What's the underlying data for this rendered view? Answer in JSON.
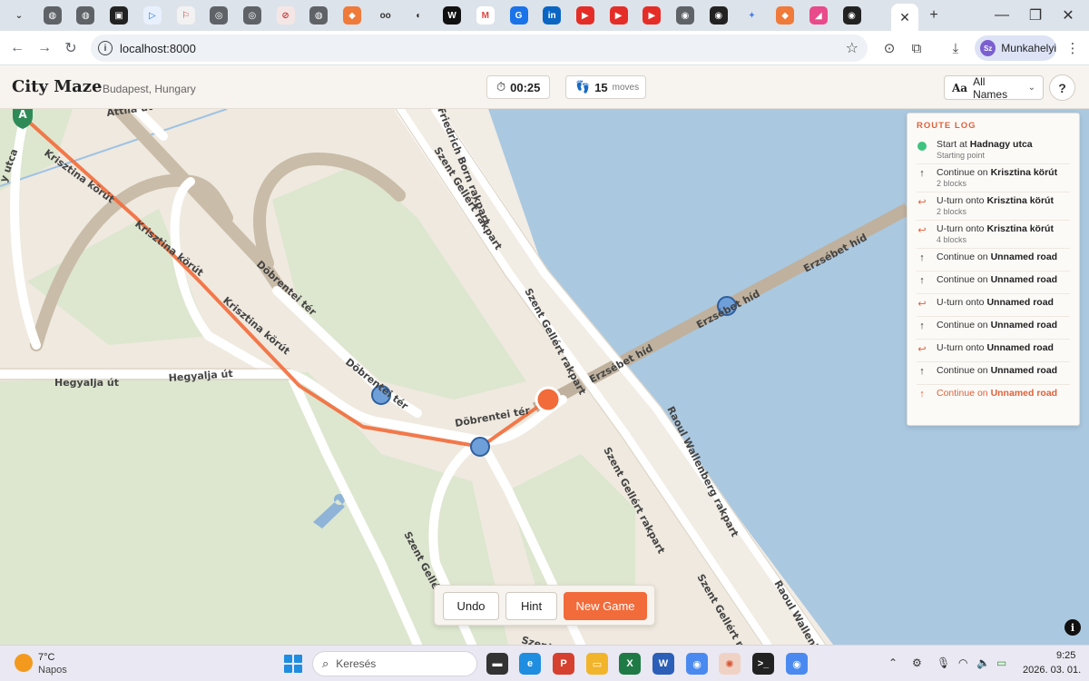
{
  "browser": {
    "favicons": [
      {
        "name": "menu-dropdown-icon",
        "glyph": "⌄",
        "bg": "#dde3ea",
        "fg": "#333"
      },
      {
        "name": "globe-icon",
        "glyph": "◍",
        "bg": "#5f6368",
        "fg": "#fff"
      },
      {
        "name": "globe-icon",
        "glyph": "◍",
        "bg": "#5f6368",
        "fg": "#fff"
      },
      {
        "name": "site-icon",
        "glyph": "▣",
        "bg": "#222",
        "fg": "#fff"
      },
      {
        "name": "play-icon",
        "glyph": "▷",
        "bg": "#e8f0fe",
        "fg": "#1a73e8"
      },
      {
        "name": "site-icon",
        "glyph": "⚐",
        "bg": "#f2f2f2",
        "fg": "#c33"
      },
      {
        "name": "globe-icon",
        "glyph": "◎",
        "bg": "#5f6368",
        "fg": "#fff"
      },
      {
        "name": "globe-icon",
        "glyph": "◎",
        "bg": "#5f6368",
        "fg": "#fff"
      },
      {
        "name": "site-icon",
        "glyph": "⊘",
        "bg": "#f5e6e6",
        "fg": "#c33"
      },
      {
        "name": "globe-icon",
        "glyph": "◍",
        "bg": "#5f6368",
        "fg": "#fff"
      },
      {
        "name": "site-icon",
        "glyph": "◆",
        "bg": "#f07a3a",
        "fg": "#fff"
      },
      {
        "name": "glasses-icon",
        "glyph": "oo",
        "bg": "#dde3ea",
        "fg": "#333"
      },
      {
        "name": "moon-icon",
        "glyph": "◐",
        "bg": "#dde3ea",
        "fg": "#222"
      },
      {
        "name": "site-icon",
        "glyph": "W",
        "bg": "#111",
        "fg": "#fff"
      },
      {
        "name": "gmail-icon",
        "glyph": "M",
        "bg": "#fff",
        "fg": "#d44"
      },
      {
        "name": "site-icon",
        "glyph": "G",
        "bg": "#1a73e8",
        "fg": "#fff"
      },
      {
        "name": "linkedin-icon",
        "glyph": "in",
        "bg": "#0a66c2",
        "fg": "#fff"
      },
      {
        "name": "youtube-icon",
        "glyph": "▶",
        "bg": "#e52d27",
        "fg": "#fff"
      },
      {
        "name": "youtube-icon",
        "glyph": "▶",
        "bg": "#e52d27",
        "fg": "#fff"
      },
      {
        "name": "youtube-icon",
        "glyph": "▶",
        "bg": "#e52d27",
        "fg": "#fff"
      },
      {
        "name": "site-icon",
        "glyph": "◉",
        "bg": "#5f6368",
        "fg": "#fff"
      },
      {
        "name": "github-icon",
        "glyph": "◉",
        "bg": "#222",
        "fg": "#fff"
      },
      {
        "name": "gemini-icon",
        "glyph": "✦",
        "bg": "#dde3ea",
        "fg": "#4a7de8"
      },
      {
        "name": "site-icon",
        "glyph": "◆",
        "bg": "#f07a3a",
        "fg": "#fff"
      },
      {
        "name": "site-icon",
        "glyph": "◢",
        "bg": "#e84a8a",
        "fg": "#fff"
      },
      {
        "name": "github-icon",
        "glyph": "◉",
        "bg": "#222",
        "fg": "#fff"
      }
    ],
    "url": "localhost:8000",
    "profile_initials": "Sz",
    "profile_name": "Munkahelyi"
  },
  "header": {
    "title": "City Maze",
    "subtitle": "Budapest, Hungary",
    "timer": "00:25",
    "moves_count": "15",
    "moves_label": "moves",
    "names_aa": "Aa",
    "names_selected": "All Names",
    "help": "?"
  },
  "map": {
    "labels": {
      "attila": "Attila út",
      "hegyalja1": "Hegyalja út",
      "hegyalja2": "Hegyalja út",
      "dobrentei1": "Döbrentei tér",
      "dobrentei2": "Döbrentei tér",
      "dobrentei3": "Döbrentei tér",
      "born": "Friedrich Born rakpart",
      "gellert1": "Szent Gellért rakpart",
      "gellert2": "Szent Gellért rakpart",
      "gellert3": "Szent Gellért rakpart",
      "gellert4": "Szent Gellért rakpart",
      "gellert5": "Szent Gellért r",
      "wallenberg1": "Raoul Wallenberg rakpart",
      "wallenberg2": "Raoul Wallenbe",
      "erzsebet1": "Erzsébet híd",
      "erzsebet2": "Erzsébet híd",
      "erzsebet3": "Erzsébet híd",
      "krisztina1": "Krisztina körút",
      "krisztina2": "Krisztina körút",
      "krisztina3": "Krisztina körút",
      "utca": "y utca",
      "szent_bottom": "Szent",
      "start_marker": "A"
    },
    "colors": {
      "water": "#aac8e0",
      "route": "#f26b3a",
      "park": "#dde6cf",
      "land": "#efe9df"
    }
  },
  "route_log": {
    "title": "ROUTE LOG",
    "items": [
      {
        "kind": "start",
        "action": "Start at",
        "street": "Hadnagy utca",
        "sub": "Starting point"
      },
      {
        "kind": "straight",
        "action": "Continue on",
        "street": "Krisztina körút",
        "sub": "2 blocks"
      },
      {
        "kind": "uturn",
        "action": "U-turn onto",
        "street": "Krisztina körút",
        "sub": "2 blocks"
      },
      {
        "kind": "uturn",
        "action": "U-turn onto",
        "street": "Krisztina körút",
        "sub": "4 blocks"
      },
      {
        "kind": "straight",
        "action": "Continue on",
        "street": "Unnamed road",
        "sub": ""
      },
      {
        "kind": "straight",
        "action": "Continue on",
        "street": "Unnamed road",
        "sub": ""
      },
      {
        "kind": "uturn",
        "action": "U-turn onto",
        "street": "Unnamed road",
        "sub": ""
      },
      {
        "kind": "straight",
        "action": "Continue on",
        "street": "Unnamed road",
        "sub": ""
      },
      {
        "kind": "uturn",
        "action": "U-turn onto",
        "street": "Unnamed road",
        "sub": ""
      },
      {
        "kind": "straight",
        "action": "Continue on",
        "street": "Unnamed road",
        "sub": ""
      },
      {
        "kind": "current",
        "action": "Continue on",
        "street": "Unnamed road",
        "sub": ""
      }
    ]
  },
  "controls": {
    "undo": "Undo",
    "hint": "Hint",
    "new_game": "New Game"
  },
  "taskbar": {
    "weather_temp": "7°C",
    "weather_desc": "Napos",
    "search_placeholder": "Keresés",
    "time": "9:25",
    "date": "2026. 03. 01."
  }
}
